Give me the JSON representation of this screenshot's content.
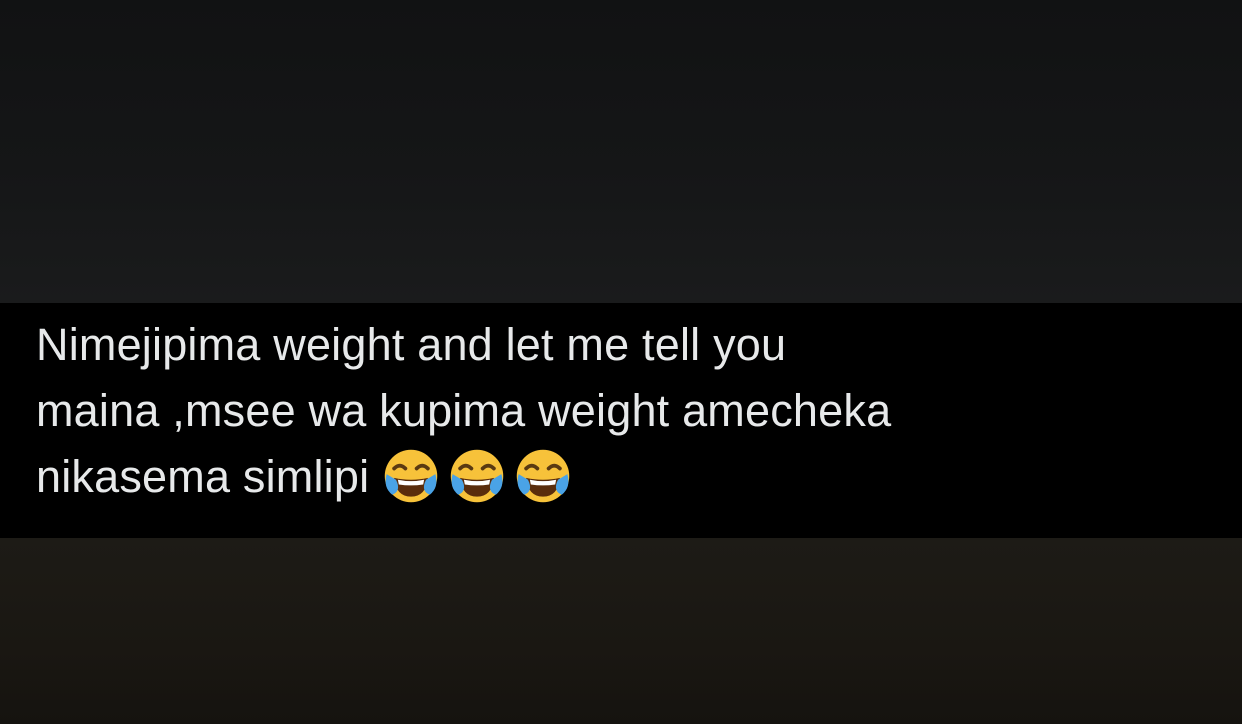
{
  "tweet": {
    "lines": [
      "Nimejipima weight and let me tell you",
      "maina ,msee wa kupima weight amecheka",
      "nikasema simlipi"
    ],
    "emojis": [
      "tears-of-joy-emoji",
      "tears-of-joy-emoji",
      "tears-of-joy-emoji"
    ]
  },
  "colors": {
    "text": "#e7e9ea",
    "band": "#000000",
    "emoji_face": "#f7c23a",
    "emoji_tears": "#4aa3e6"
  }
}
